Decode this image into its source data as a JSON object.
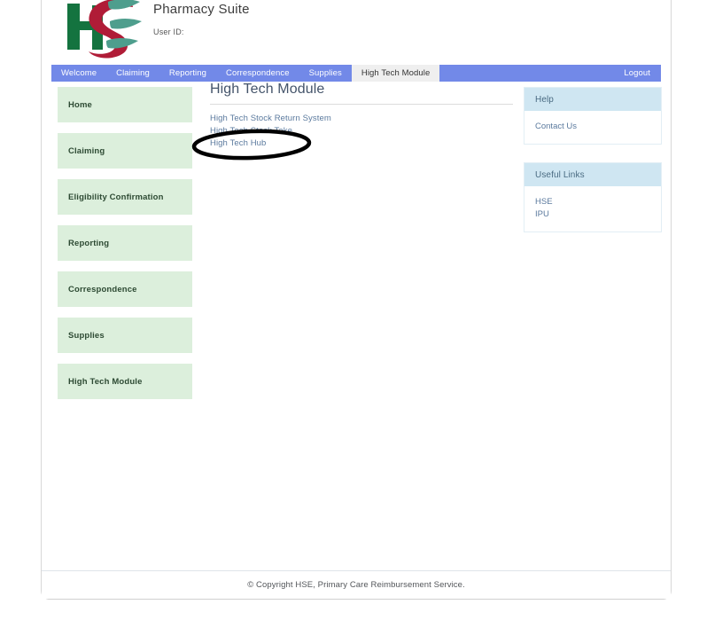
{
  "header": {
    "app_title": "Pharmacy Suite",
    "user_id_label": "User ID:",
    "logo_name": "hse-logo"
  },
  "navbar": {
    "items": [
      {
        "label": "Welcome",
        "active": false
      },
      {
        "label": "Claiming",
        "active": false
      },
      {
        "label": "Reporting",
        "active": false
      },
      {
        "label": "Correspondence",
        "active": false
      },
      {
        "label": "Supplies",
        "active": false
      },
      {
        "label": "High Tech Module",
        "active": true
      }
    ],
    "logout_label": "Logout",
    "background_color": "#7289e8",
    "active_tab_color": "#efefef"
  },
  "sidebar": {
    "items": [
      {
        "label": "Home"
      },
      {
        "label": "Claiming"
      },
      {
        "label": "Eligibility Confirmation"
      },
      {
        "label": "Reporting"
      },
      {
        "label": "Correspondence"
      },
      {
        "label": "Supplies"
      },
      {
        "label": "High Tech Module"
      }
    ],
    "item_color": "#dcefdc"
  },
  "main": {
    "heading": "High Tech Module",
    "links": [
      {
        "label": "High Tech Stock Return System"
      },
      {
        "label": "High Tech Stock Take"
      },
      {
        "label": "High Tech Hub"
      }
    ],
    "link_color": "#5b7a9e"
  },
  "right_rail": {
    "panels": [
      {
        "title": "Help",
        "links": [
          {
            "label": "Contact Us"
          }
        ]
      },
      {
        "title": "Useful Links",
        "links": [
          {
            "label": "HSE"
          },
          {
            "label": "IPU"
          }
        ]
      }
    ],
    "header_color": "#cfe6f2"
  },
  "footer": {
    "text": "© Copyright HSE, Primary Care Reimbursement Service."
  },
  "annotation": {
    "shape": "ellipse",
    "target_label": "High Tech Hub",
    "stroke_color": "#000000"
  }
}
